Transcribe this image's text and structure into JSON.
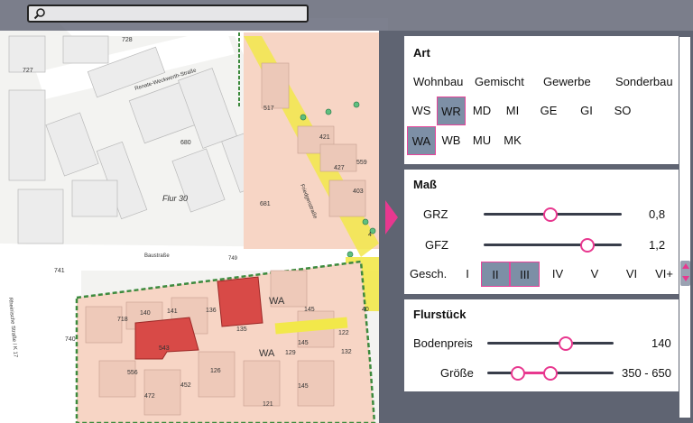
{
  "search": {
    "value": "",
    "placeholder": "",
    "icon": "search-icon"
  },
  "map": {
    "labels": [
      "728",
      "727",
      "Renate-Weckwerth-Straße",
      "680",
      "Flur 30",
      "681",
      "Friedgenstraße",
      "Baustraße",
      "749",
      "741",
      "740",
      "Rheinische Straße / K 17",
      "718",
      "140",
      "141",
      "136",
      "135",
      "543",
      "556",
      "472",
      "452",
      "126",
      "129",
      "145",
      "122",
      "WA",
      "WA",
      "517",
      "427",
      "559",
      "403",
      "421",
      "145",
      "132",
      "145",
      "121",
      "40",
      "4"
    ],
    "colors": {
      "residential": "#f7d5c5",
      "selected_lot": "#d84a47",
      "road": "#f2e84a",
      "boundary": "#3d8a3d"
    }
  },
  "panel": {
    "art": {
      "title": "Art",
      "groups": [
        "Wohnbau",
        "Gemischt",
        "Gewerbe",
        "Sonderbau"
      ],
      "row1": [
        "WS",
        "WR",
        "MD",
        "MI",
        "GE",
        "GI",
        "SO"
      ],
      "row2": [
        "WA",
        "WB",
        "MU",
        "MK"
      ],
      "selected": [
        "WR",
        "WA"
      ]
    },
    "mass": {
      "title": "Maß",
      "grz": {
        "label": "GRZ",
        "value": "0,8",
        "level": 0.5
      },
      "gfz": {
        "label": "GFZ",
        "value": "1,2",
        "level": 0.75
      },
      "gesch": {
        "label": "Gesch.",
        "options": [
          "I",
          "II",
          "III",
          "IV",
          "V",
          "VI",
          "VI+"
        ],
        "selected": [
          "II",
          "III"
        ]
      }
    },
    "flurstueck": {
      "title": "Flurstück",
      "bodenpreis": {
        "label": "Bodenpreis",
        "value": "140",
        "level": 0.6
      },
      "groesse": {
        "label": "Größe",
        "value": "350 - 650",
        "low": 0.22,
        "high": 0.47
      }
    }
  },
  "colors": {
    "accent": "#e8388f",
    "selected_bg": "#7d8fa6",
    "panel_bg": "#5f6472",
    "topbar": "#585c6e"
  }
}
